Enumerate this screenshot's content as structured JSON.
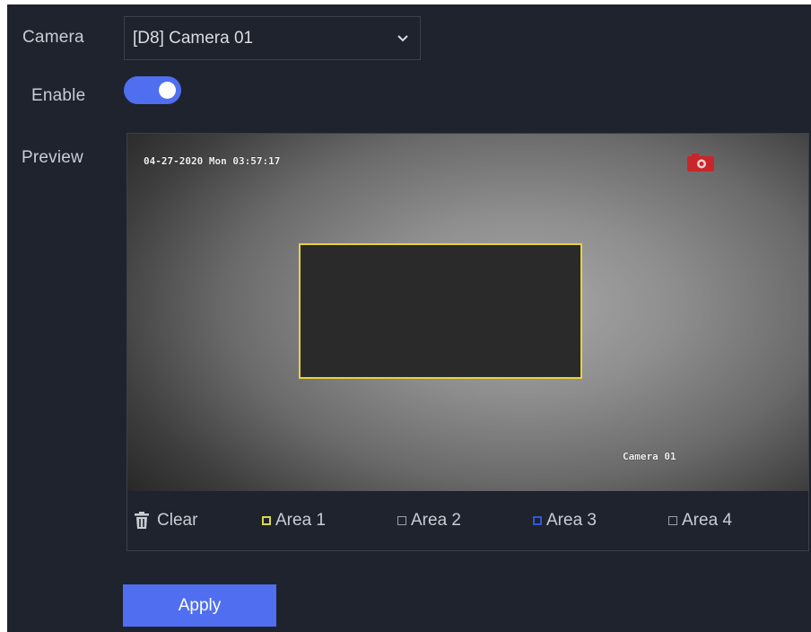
{
  "form": {
    "camera_label": "Camera",
    "camera_value": "[D8] Camera 01",
    "enable_label": "Enable",
    "enable_on": true,
    "preview_label": "Preview"
  },
  "preview": {
    "osd_timestamp": "04-27-2020 Mon 03:57:17",
    "osd_camera_name": "Camera 01",
    "mask_color": "#e6d43a"
  },
  "toolbar": {
    "clear_label": "Clear",
    "areas": [
      {
        "label": "Area 1",
        "color": "#d8d84a"
      },
      {
        "label": "Area 2",
        "color": "#9aa0aa"
      },
      {
        "label": "Area 3",
        "color": "#2f58d8"
      },
      {
        "label": "Area 4",
        "color": "#9aa0aa"
      }
    ]
  },
  "actions": {
    "apply_label": "Apply"
  },
  "colors": {
    "accent": "#4f6ff0",
    "background": "#1f232e"
  }
}
